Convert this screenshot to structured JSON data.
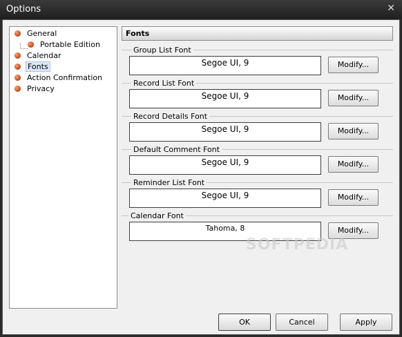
{
  "window": {
    "title": "Options",
    "close_glyph": "✕"
  },
  "tree": {
    "items": [
      {
        "label": "General",
        "icon": "bullet-icon"
      },
      {
        "label": "Portable Edition",
        "icon": "bullet-icon"
      },
      {
        "label": "Calendar",
        "icon": "bullet-icon"
      },
      {
        "label": "Fonts",
        "icon": "bullet-icon",
        "selected": true
      },
      {
        "label": "Action Confirmation",
        "icon": "bullet-icon"
      },
      {
        "label": "Privacy",
        "icon": "bullet-icon"
      }
    ]
  },
  "panel": {
    "header": "Fonts",
    "groups": [
      {
        "title": "Group List Font",
        "value": "Segoe UI, 9",
        "button": "Modify..."
      },
      {
        "title": "Record List Font",
        "value": "Segoe UI, 9",
        "button": "Modify..."
      },
      {
        "title": "Record Details Font",
        "value": "Segoe UI, 9",
        "button": "Modify..."
      },
      {
        "title": "Default Comment Font",
        "value": "Segoe UI, 9",
        "button": "Modify..."
      },
      {
        "title": "Reminder List Font",
        "value": "Segoe UI, 9",
        "button": "Modify..."
      },
      {
        "title": "Calendar Font",
        "value": "Tahoma, 8",
        "button": "Modify..."
      }
    ]
  },
  "watermark": "SOFTPEDIA",
  "footer": {
    "ok": "OK",
    "cancel": "Cancel",
    "apply": "Apply"
  },
  "colors": {
    "title_bar": "#2b2b2b",
    "client_bg": "#f0f0f0",
    "bullet": "#c8501e",
    "selection": "#dbe8f7"
  }
}
